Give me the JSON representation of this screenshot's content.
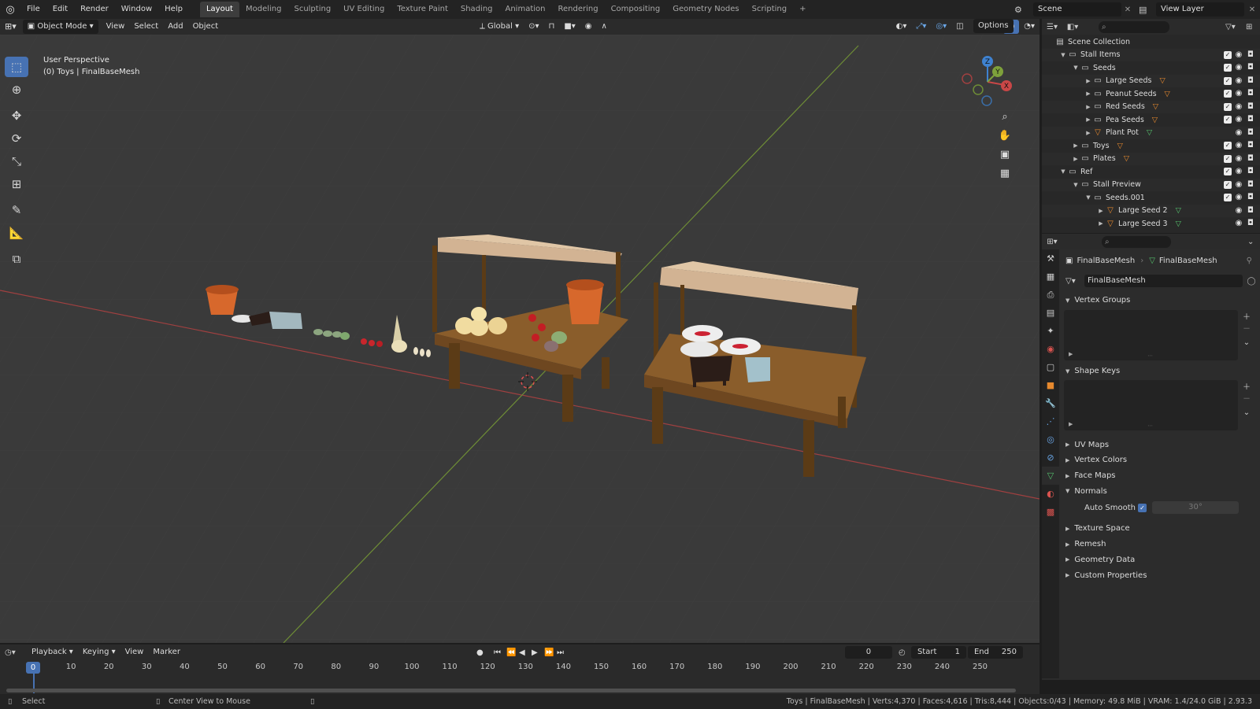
{
  "topbar": {
    "menus": [
      "File",
      "Edit",
      "Render",
      "Window",
      "Help"
    ],
    "workspaces": [
      "Layout",
      "Modeling",
      "Sculpting",
      "UV Editing",
      "Texture Paint",
      "Shading",
      "Animation",
      "Rendering",
      "Compositing",
      "Geometry Nodes",
      "Scripting"
    ],
    "active_workspace": "Layout",
    "add_tab": "+",
    "scene_name": "Scene",
    "view_layer_name": "View Layer"
  },
  "viewport_header": {
    "mode": "Object Mode",
    "menus": [
      "View",
      "Select",
      "Add",
      "Object"
    ],
    "orientation": "Global",
    "options": "Options"
  },
  "viewport": {
    "perspective": "User Perspective",
    "collection_info": "(0) Toys | FinalBaseMesh",
    "gizmo": {
      "x": "X",
      "y": "Y",
      "z": "Z"
    }
  },
  "outliner": {
    "items": [
      {
        "name": "Scene Collection",
        "depth": 0,
        "tri": "",
        "icon": "scene-collection"
      },
      {
        "name": "Stall Items",
        "depth": 1,
        "tri": "▼",
        "icon": "collection",
        "cb": true
      },
      {
        "name": "Seeds",
        "depth": 2,
        "tri": "▼",
        "icon": "collection",
        "cb": true
      },
      {
        "name": "Large Seeds",
        "depth": 3,
        "tri": "▶",
        "icon": "collection",
        "cb": true,
        "badge": "▽"
      },
      {
        "name": "Peanut Seeds",
        "depth": 3,
        "tri": "▶",
        "icon": "collection",
        "cb": true,
        "badge": "▽"
      },
      {
        "name": "Red Seeds",
        "depth": 3,
        "tri": "▶",
        "icon": "collection",
        "cb": true,
        "badge": "▽"
      },
      {
        "name": "Pea Seeds",
        "depth": 3,
        "tri": "▶",
        "icon": "collection",
        "cb": true,
        "badge": "▽"
      },
      {
        "name": "Plant Pot",
        "depth": 3,
        "tri": "▶",
        "icon": "mesh",
        "cb": false,
        "badge": "▽"
      },
      {
        "name": "Toys",
        "depth": 2,
        "tri": "▶",
        "icon": "collection",
        "cb": true,
        "badge": "▽"
      },
      {
        "name": "Plates",
        "depth": 2,
        "tri": "▶",
        "icon": "collection",
        "cb": true,
        "badge": "▽"
      },
      {
        "name": "Ref",
        "depth": 1,
        "tri": "▼",
        "icon": "collection",
        "cb": true
      },
      {
        "name": "Stall Preview",
        "depth": 2,
        "tri": "▼",
        "icon": "collection",
        "cb": true
      },
      {
        "name": "Seeds.001",
        "depth": 3,
        "tri": "▼",
        "icon": "collection",
        "cb": true
      },
      {
        "name": "Large Seed 2",
        "depth": 4,
        "tri": "▶",
        "icon": "mesh",
        "cb": false,
        "badge": "▽"
      },
      {
        "name": "Large Seed 3",
        "depth": 4,
        "tri": "▶",
        "icon": "mesh",
        "cb": false,
        "badge": "▽"
      }
    ]
  },
  "properties": {
    "object_name": "FinalBaseMesh",
    "mesh_name": "FinalBaseMesh",
    "data_name": "FinalBaseMesh",
    "panels": {
      "vertex_groups": "Vertex Groups",
      "shape_keys": "Shape Keys",
      "uv_maps": "UV Maps",
      "vertex_colors": "Vertex Colors",
      "face_maps": "Face Maps",
      "normals": "Normals",
      "auto_smooth_label": "Auto Smooth",
      "auto_smooth_angle": "30°",
      "texture_space": "Texture Space",
      "remesh": "Remesh",
      "geometry_data": "Geometry Data",
      "custom_properties": "Custom Properties"
    }
  },
  "timeline": {
    "menus": [
      "Playback",
      "Keying",
      "View",
      "Marker"
    ],
    "current_frame": "0",
    "start_label": "Start",
    "start_value": "1",
    "end_label": "End",
    "end_value": "250",
    "frame_marker": "0",
    "ticks": [
      "10",
      "20",
      "30",
      "40",
      "50",
      "60",
      "70",
      "80",
      "90",
      "100",
      "110",
      "120",
      "130",
      "140",
      "150",
      "160",
      "170",
      "180",
      "190",
      "200",
      "210",
      "220",
      "230",
      "240",
      "250"
    ]
  },
  "statusbar": {
    "select": "Select",
    "center_view": "Center View to Mouse",
    "stats": "Toys | FinalBaseMesh | Verts:4,370 | Faces:4,616 | Tris:8,444 | Objects:0/43 | Memory: 49.8 MiB | VRAM: 1.4/24.0 GiB | 2.93.3"
  },
  "colors": {
    "accent": "#4772b3",
    "x_axis": "#c94747",
    "y_axis": "#7ea13b",
    "z_axis": "#3f82d0",
    "orange": "#e6892e",
    "green": "#55c16d"
  }
}
